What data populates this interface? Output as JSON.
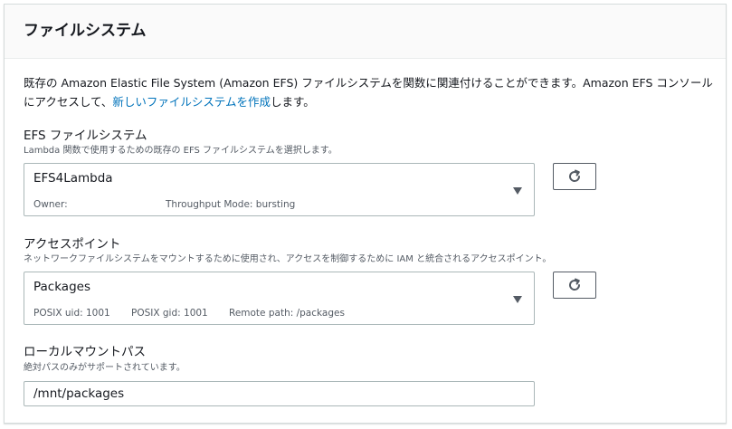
{
  "header": {
    "title": "ファイルシステム"
  },
  "description": {
    "text_before_link": "既存の Amazon Elastic File System (Amazon EFS) ファイルシステムを関数に関連付けることができます。Amazon EFS コンソールにアクセスして、",
    "link_text": "新しいファイルシステムを作成",
    "text_after_link": "します。"
  },
  "efs_field": {
    "label": "EFS ファイルシステム",
    "help": "Lambda 関数で使用するための既存の EFS ファイルシステムを選択します。",
    "selected_value": "EFS4Lambda",
    "meta": {
      "owner": "Owner:",
      "throughput": "Throughput Mode: bursting"
    }
  },
  "access_point_field": {
    "label": "アクセスポイント",
    "help": "ネットワークファイルシステムをマウントするために使用され、アクセスを制御するために IAM と統合されるアクセスポイント。",
    "selected_value": "Packages",
    "meta": {
      "uid": "POSIX uid: 1001",
      "gid": "POSIX gid: 1001",
      "remote_path": "Remote path: /packages"
    }
  },
  "mount_path_field": {
    "label": "ローカルマウントパス",
    "help": "絶対パスのみがサポートされています。",
    "value": "/mnt/packages"
  },
  "icons": {
    "refresh": "refresh-icon",
    "caret": "caret-down-icon"
  },
  "colors": {
    "link": "#0073bb",
    "text": "#16191f",
    "secondary_text": "#545b64",
    "border": "#aab7b8",
    "header_bg": "#fafafa"
  }
}
